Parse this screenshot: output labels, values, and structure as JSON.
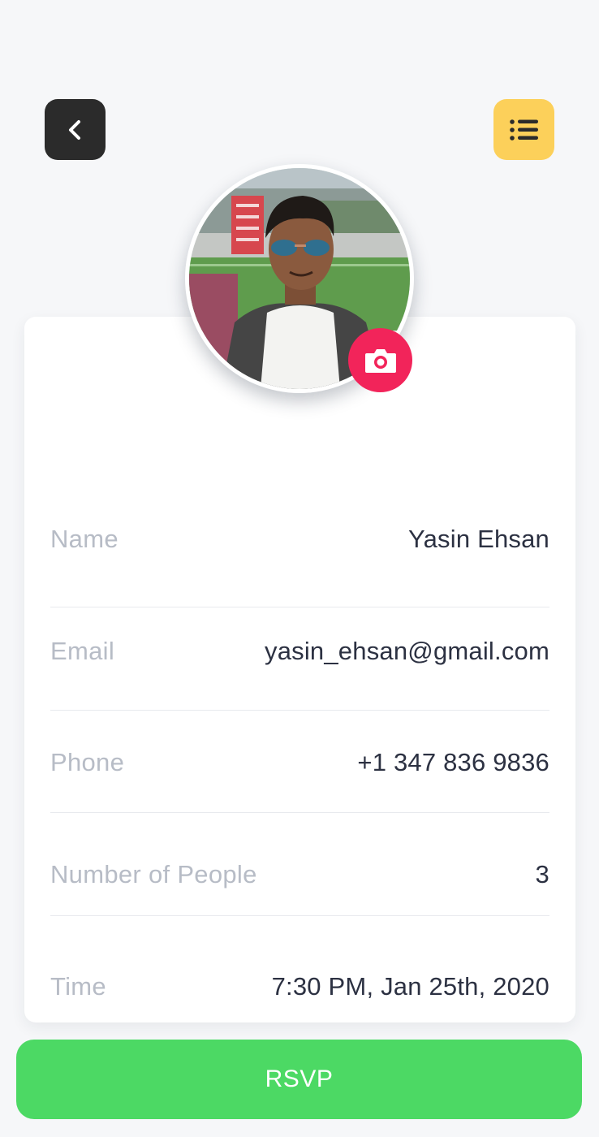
{
  "header": {
    "back_icon": "chevron-left-icon",
    "menu_icon": "list-icon"
  },
  "profile": {
    "camera_icon": "camera-icon",
    "fields": [
      {
        "label": "Name",
        "value": "Yasin Ehsan"
      },
      {
        "label": "Email",
        "value": "yasin_ehsan@gmail.com"
      },
      {
        "label": "Phone",
        "value": "+1 347 836 9836"
      },
      {
        "label": "Number of People",
        "value": "3"
      },
      {
        "label": "Time",
        "value": "7:30 PM, Jan 25th, 2020"
      }
    ]
  },
  "rsvp_button": {
    "label": "RSVP"
  },
  "colors": {
    "background": "#f6f7f9",
    "back_button": "#2b2b2b",
    "menu_button": "#fcd05a",
    "camera_button": "#f2245a",
    "rsvp_button": "#4cd964",
    "label_text": "#b7bcc6",
    "value_text": "#2c3142"
  }
}
